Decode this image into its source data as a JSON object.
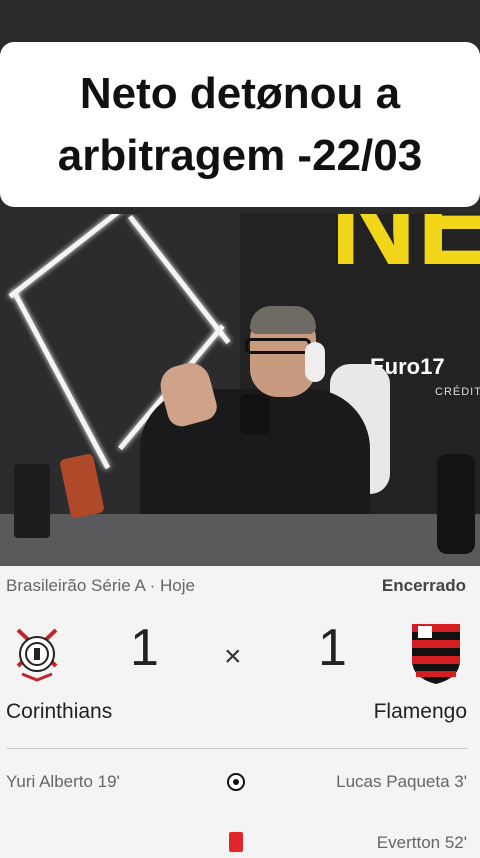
{
  "caption": {
    "line1": "Neto detønou a",
    "line2": "arbitragem -22/03"
  },
  "video": {
    "sign_text": "NETO",
    "sponsor": "Euro17",
    "sponsor_sub": "CRÉDIT"
  },
  "match": {
    "league": "Brasileirão Série A · Hoje",
    "status": "Encerrado",
    "home": {
      "name": "Corinthians",
      "score": "1",
      "logo": "corinthians-crest-icon"
    },
    "away": {
      "name": "Flamengo",
      "score": "1",
      "logo": "flamengo-crest-icon"
    },
    "separator": "×",
    "events": [
      {
        "left": "Yuri Alberto 19'",
        "right": "Lucas Paqueta 3'",
        "icon": "soccer-ball-icon"
      },
      {
        "left": "",
        "right": "Evertton 52'",
        "icon": "red-card-icon"
      }
    ]
  },
  "colors": {
    "accent": "#f2d619",
    "red_card": "#e3262a",
    "flamengo_red": "#d41e24"
  }
}
